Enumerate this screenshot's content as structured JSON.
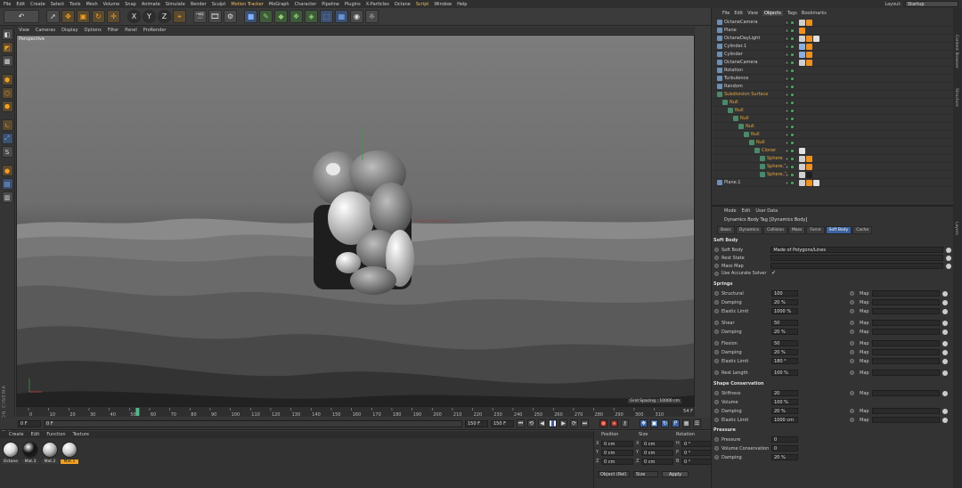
{
  "menubar": {
    "items": [
      "File",
      "Edit",
      "Create",
      "Select",
      "Tools",
      "Mesh",
      "Volume",
      "Snap",
      "Animate",
      "Simulate",
      "Render",
      "Sculpt",
      "Motion Tracker",
      "MoGraph",
      "Character",
      "Pipeline",
      "Plugins",
      "X-Particles",
      "Octane",
      "Script",
      "Window",
      "Help"
    ],
    "layout_label": "Layout:",
    "layout_value": "Startup"
  },
  "toolbar": {
    "axis_x": "X",
    "axis_y": "Y",
    "axis_z": "Z"
  },
  "viewport": {
    "menu": [
      "View",
      "Cameras",
      "Display",
      "Options",
      "Filter",
      "Panel",
      "ProRender"
    ],
    "label": "Perspective",
    "grid_spacing": "Grid Spacing : 10000 cm"
  },
  "timeline": {
    "ticks": [
      "0",
      "10",
      "20",
      "30",
      "40",
      "50",
      "60",
      "70",
      "80",
      "90",
      "100",
      "110",
      "120",
      "130",
      "140",
      "150",
      "160",
      "170",
      "180",
      "190",
      "200",
      "210",
      "220",
      "230",
      "240",
      "250",
      "260",
      "270",
      "280",
      "290",
      "300",
      "310"
    ],
    "current_frame": 54,
    "end_label": "54 F"
  },
  "transport": {
    "start": "0 F",
    "current": "0 F",
    "end": "150 F",
    "end2": "150 F"
  },
  "materials": {
    "menu": [
      "Create",
      "Edit",
      "Function",
      "Texture"
    ],
    "items": [
      {
        "name": "Octane",
        "color": "#d8d8d8",
        "selected": false
      },
      {
        "name": "Mat.3",
        "color": "#151515",
        "selected": false
      },
      {
        "name": "Mat.2",
        "color": "#bdbdbd",
        "selected": false
      },
      {
        "name": "Mat.1",
        "color": "#cfcfcf",
        "selected": true
      }
    ]
  },
  "coordinates": {
    "headers": [
      "Position",
      "Size",
      "Rotation"
    ],
    "rows": [
      {
        "axis": "X",
        "pos": "0 cm",
        "saxis": "X",
        "size": "0 cm",
        "raxis": "H",
        "rot": "0 °"
      },
      {
        "axis": "Y",
        "pos": "0 cm",
        "saxis": "Y",
        "size": "0 cm",
        "raxis": "P",
        "rot": "0 °"
      },
      {
        "axis": "Z",
        "pos": "0 cm",
        "saxis": "Z",
        "size": "0 cm",
        "raxis": "B",
        "rot": "0 °"
      }
    ],
    "mode1": "Object (Rel)",
    "mode2": "Size",
    "apply": "Apply"
  },
  "objects": {
    "tabs": [
      "File",
      "Edit",
      "View",
      "Objects",
      "Tags",
      "Bookmarks"
    ],
    "active_tab": "Objects",
    "rows": [
      {
        "name": "OctaneCamera",
        "indent": 0,
        "style": "",
        "tags": [
          "#d0d0d0",
          "#f09020"
        ]
      },
      {
        "name": "Plane",
        "indent": 0,
        "style": "",
        "tags": [
          "#f09020"
        ]
      },
      {
        "name": "OctaneDayLight",
        "indent": 0,
        "style": "",
        "tags": [
          "#d0d0d0",
          "#f09020",
          "#e0e0e0"
        ]
      },
      {
        "name": "Cylinder.1",
        "indent": 0,
        "style": "",
        "tags": [
          "#8ab0e0",
          "#f09020"
        ]
      },
      {
        "name": "Cylinder",
        "indent": 0,
        "style": "",
        "tags": [
          "#8ab0e0",
          "#f09020"
        ]
      },
      {
        "name": "OctaneCamera",
        "indent": 0,
        "style": "",
        "tags": [
          "#d0d0d0",
          "#f09020"
        ]
      },
      {
        "name": "Rotation",
        "indent": 0,
        "style": "",
        "tags": []
      },
      {
        "name": "Turbulence",
        "indent": 0,
        "style": "",
        "tags": []
      },
      {
        "name": "Random",
        "indent": 0,
        "style": "",
        "tags": []
      },
      {
        "name": "Subdivision Surface",
        "indent": 0,
        "style": "orange",
        "tags": []
      },
      {
        "name": "Null",
        "indent": 1,
        "style": "orange",
        "tags": []
      },
      {
        "name": "Null",
        "indent": 2,
        "style": "orange",
        "tags": []
      },
      {
        "name": "Null",
        "indent": 3,
        "style": "orange",
        "tags": []
      },
      {
        "name": "Null",
        "indent": 4,
        "style": "orange",
        "tags": []
      },
      {
        "name": "Null",
        "indent": 5,
        "style": "orange",
        "tags": []
      },
      {
        "name": "Null",
        "indent": 6,
        "style": "orange",
        "tags": []
      },
      {
        "name": "Cloner",
        "indent": 7,
        "style": "orange",
        "tags": [
          "#e0e0e0"
        ]
      },
      {
        "name": "Sphere",
        "indent": 8,
        "style": "orange",
        "tags": [
          "#d0d0d0",
          "#f09020"
        ]
      },
      {
        "name": "Sphere.1",
        "indent": 8,
        "style": "orange",
        "tags": [
          "#d0d0d0",
          "#f09020"
        ]
      },
      {
        "name": "Sphere.2",
        "indent": 8,
        "style": "orange",
        "tags": [
          "#d0d0d0",
          "#202020"
        ]
      },
      {
        "name": "Plane.1",
        "indent": 0,
        "style": "",
        "tags": [
          "#d0d0d0",
          "#f09020",
          "#e0e0e0"
        ]
      }
    ]
  },
  "side_tabs": [
    "Content Browser",
    "Structure",
    "Layers"
  ],
  "attributes": {
    "menu": [
      "Mode",
      "Edit",
      "User Data"
    ],
    "title": "Dynamics Body Tag [Dynamics Body]",
    "tabs": [
      "Basic",
      "Dynamics",
      "Collision",
      "Mass",
      "Force",
      "Soft Body",
      "Cache"
    ],
    "active_tab": "Soft Body",
    "sections": {
      "softbody": "Soft Body",
      "springs": "Springs",
      "shape": "Shape Conservation",
      "pressure": "Pressure"
    },
    "softbody": {
      "label": "Soft Body",
      "value": "Made of Polygons/Lines",
      "rest_state": "Rest State",
      "mass_map": "Mass Map",
      "accurate": "Use Accurate Solver",
      "accurate_check": "✓"
    },
    "springs": [
      {
        "label": "Structural",
        "value": "100",
        "map": "Map"
      },
      {
        "label": "Damping",
        "value": "20 %",
        "map": "Map"
      },
      {
        "label": "Elastic Limit",
        "value": "1000 %",
        "map": "Map"
      },
      {
        "label": "Shear",
        "value": "50",
        "map": "Map"
      },
      {
        "label": "Damping",
        "value": "20 %",
        "map": "Map"
      },
      {
        "label": "Flexion",
        "value": "50",
        "map": "Map"
      },
      {
        "label": "Damping",
        "value": "20 %",
        "map": "Map"
      },
      {
        "label": "Elastic Limit",
        "value": "180 °",
        "map": "Map"
      },
      {
        "label": "Rest Length",
        "value": "100 %",
        "map": "Map"
      }
    ],
    "shape": [
      {
        "label": "Stiffness",
        "value": "20",
        "map": "Map"
      },
      {
        "label": "Volume",
        "value": "100 %",
        "map": ""
      },
      {
        "label": "Damping",
        "value": "20 %",
        "map": "Map"
      },
      {
        "label": "Elastic Limit",
        "value": "1000 cm",
        "map": "Map"
      }
    ],
    "pressure": [
      {
        "label": "Pressure",
        "value": "0"
      },
      {
        "label": "Volume Conservation",
        "value": "0"
      },
      {
        "label": "Damping",
        "value": "20 %"
      }
    ]
  },
  "brand": "MAXON CINEMA 4D"
}
